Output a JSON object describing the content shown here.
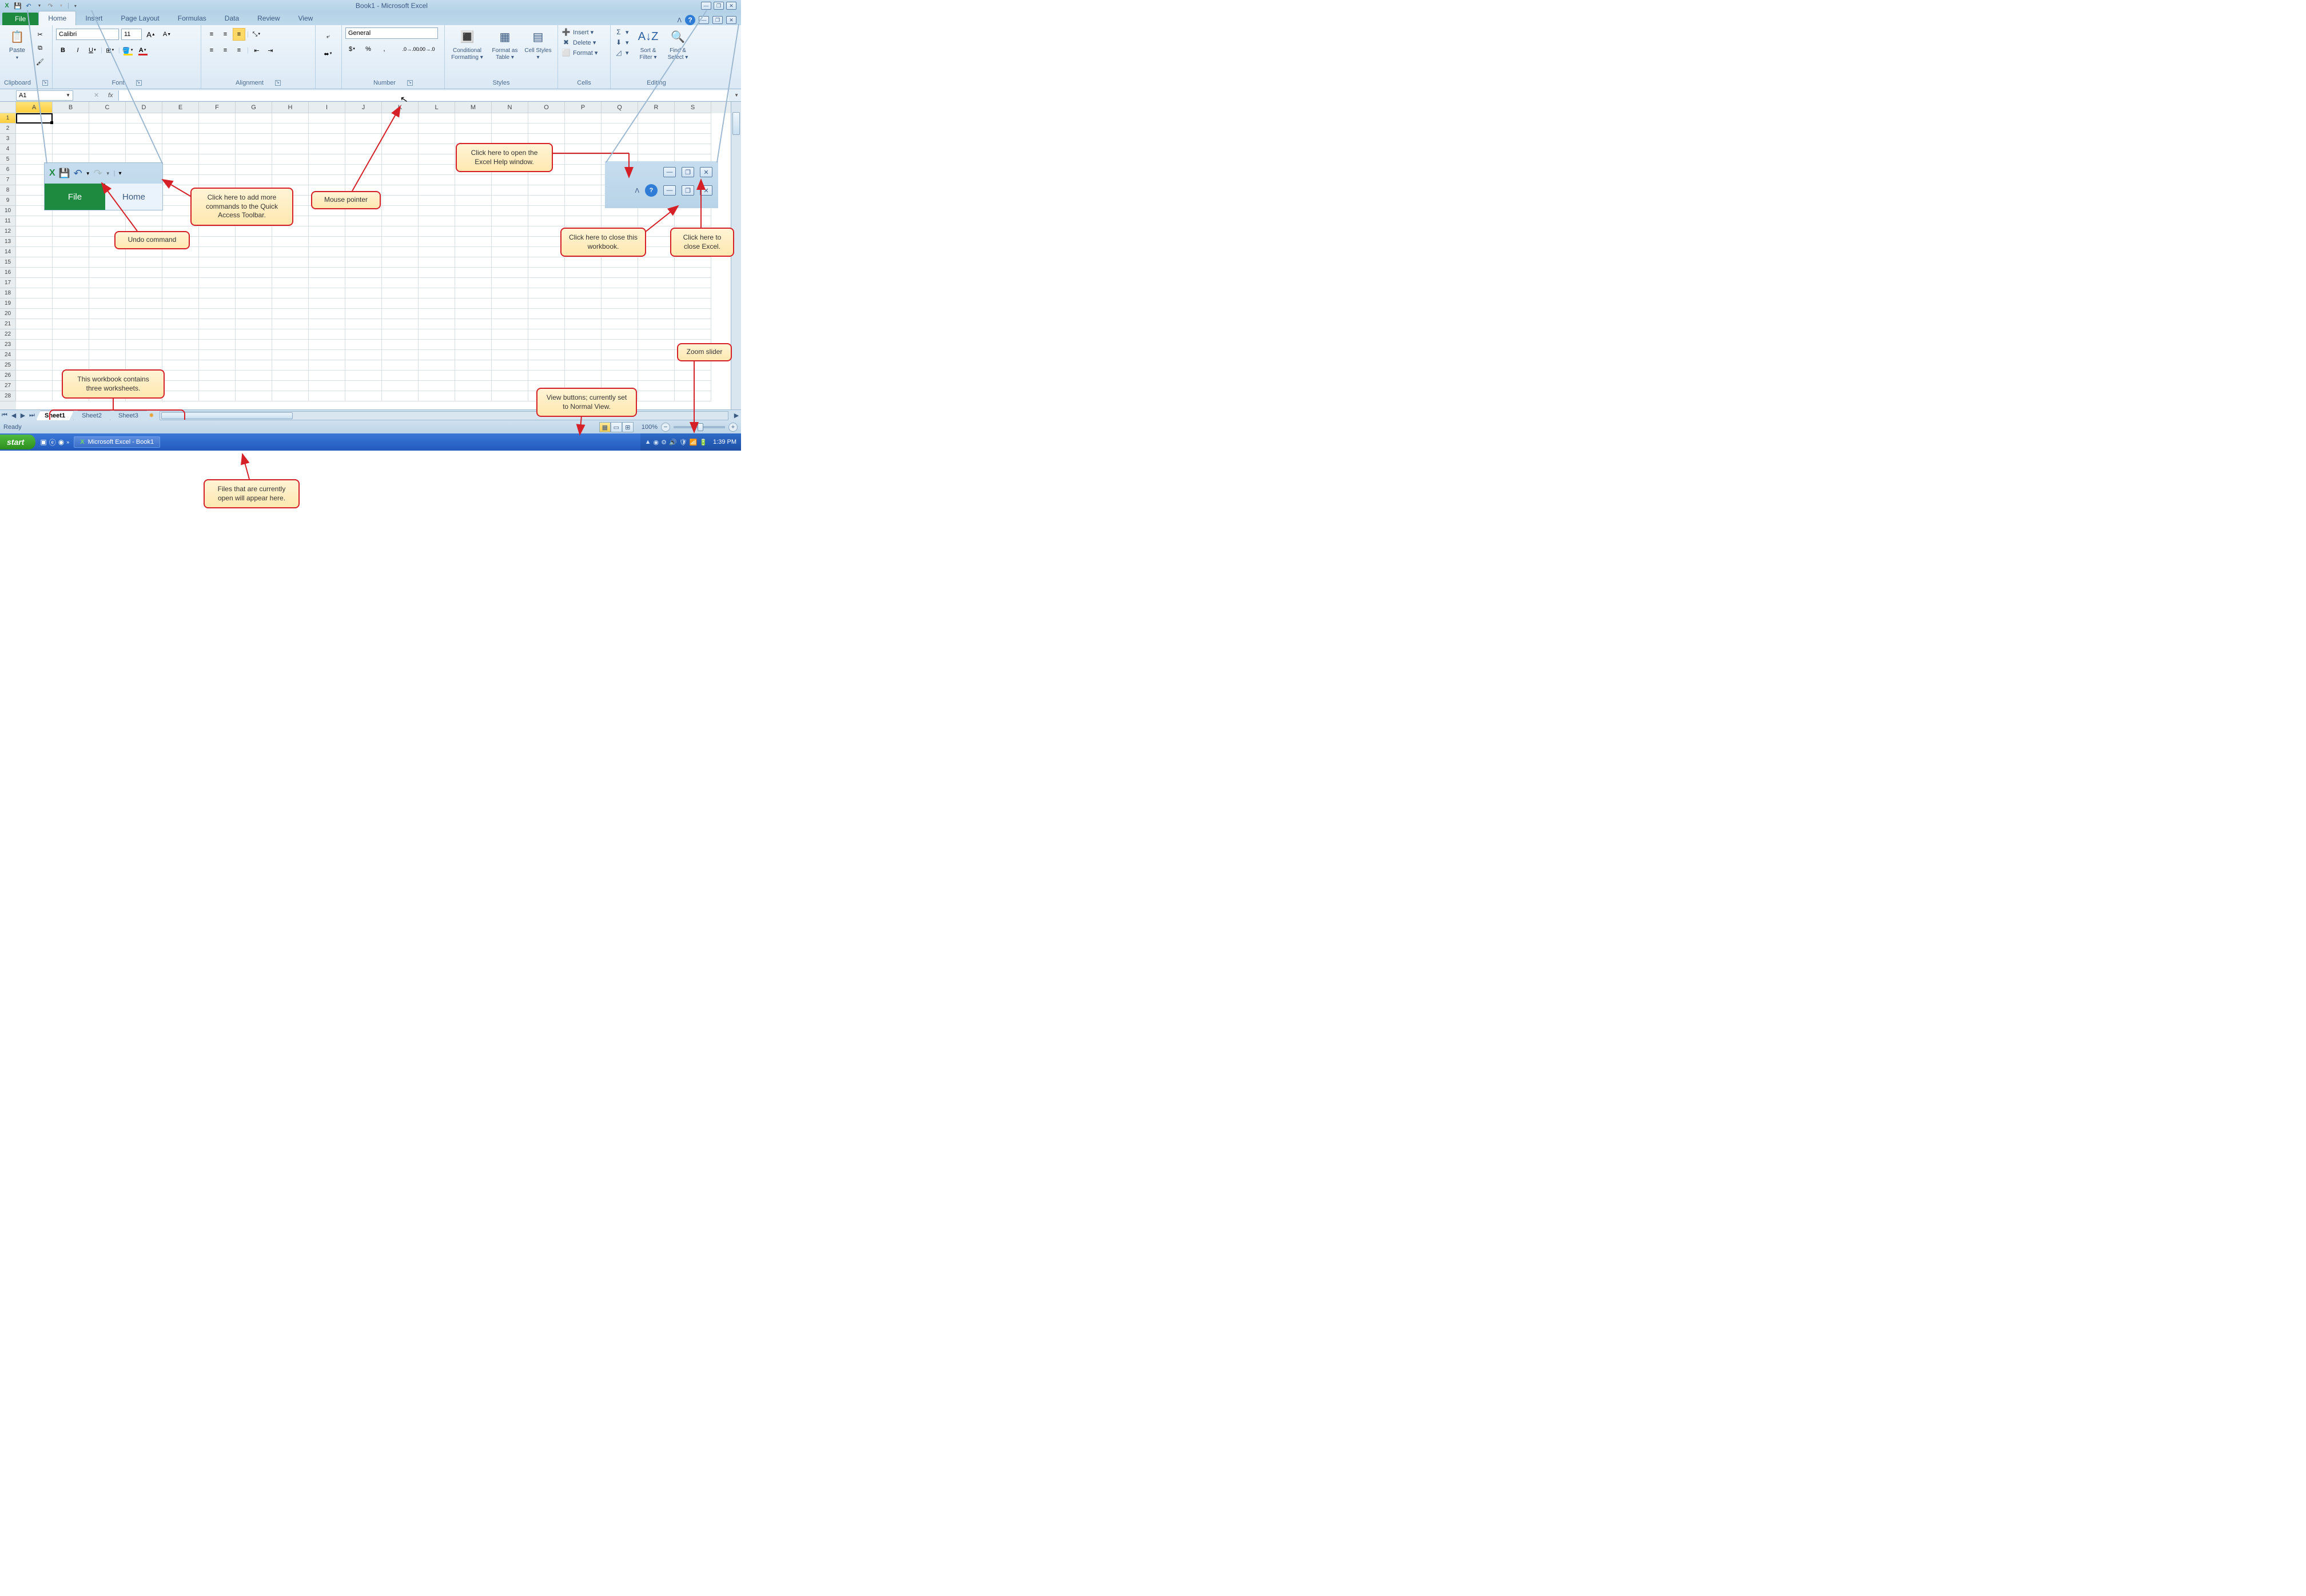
{
  "title": "Book1 - Microsoft Excel",
  "qat": {
    "save": "💾",
    "undo": "↶",
    "redo": "↷"
  },
  "tabs": {
    "file": "File",
    "home": "Home",
    "insert": "Insert",
    "pagelayout": "Page Layout",
    "formulas": "Formulas",
    "data": "Data",
    "review": "Review",
    "view": "View"
  },
  "ribbon": {
    "clipboard": {
      "paste": "Paste",
      "label": "Clipboard"
    },
    "font": {
      "name": "Calibri",
      "size": "11",
      "label": "Font"
    },
    "alignment": {
      "label": "Alignment"
    },
    "number": {
      "format": "General",
      "label": "Number"
    },
    "styles": {
      "cond": "Conditional Formatting ▾",
      "tbl": "Format as Table ▾",
      "cell": "Cell Styles ▾",
      "label": "Styles"
    },
    "cells": {
      "insert": "Insert ▾",
      "delete": "Delete ▾",
      "format": "Format ▾",
      "label": "Cells"
    },
    "editing": {
      "sort": "Sort & Filter ▾",
      "find": "Find & Select ▾",
      "label": "Editing"
    }
  },
  "namebox": "A1",
  "columns": [
    "A",
    "B",
    "C",
    "D",
    "E",
    "F",
    "G",
    "H",
    "I",
    "J",
    "K",
    "L",
    "M",
    "N",
    "O",
    "P",
    "Q",
    "R",
    "S"
  ],
  "rows": [
    "1",
    "2",
    "3",
    "4",
    "5",
    "6",
    "7",
    "8",
    "9",
    "10",
    "11",
    "12",
    "13",
    "14",
    "15",
    "16",
    "17",
    "18",
    "19",
    "20",
    "21",
    "22",
    "23",
    "24",
    "25",
    "26",
    "27",
    "28"
  ],
  "sheets": {
    "s1": "Sheet1",
    "s2": "Sheet2",
    "s3": "Sheet3"
  },
  "status": {
    "ready": "Ready",
    "zoom": "100%"
  },
  "taskbar": {
    "start": "start",
    "app": "Microsoft Excel - Book1",
    "clock": "1:39 PM"
  },
  "callouts": {
    "help": "Click here to open the Excel Help window.",
    "qat": "Click here to add more commands to the Quick Access Toolbar.",
    "undo": "Undo command",
    "mouse": "Mouse pointer",
    "closewb": "Click here to close this workbook.",
    "closexl": "Click here to close Excel.",
    "zoom": "Zoom slider",
    "views": "View buttons; currently set to Normal View.",
    "sheets": "This workbook contains three worksheets.",
    "files": "Files that are currently open will appear here."
  },
  "inset_qat": {
    "file": "File",
    "home": "Home"
  }
}
